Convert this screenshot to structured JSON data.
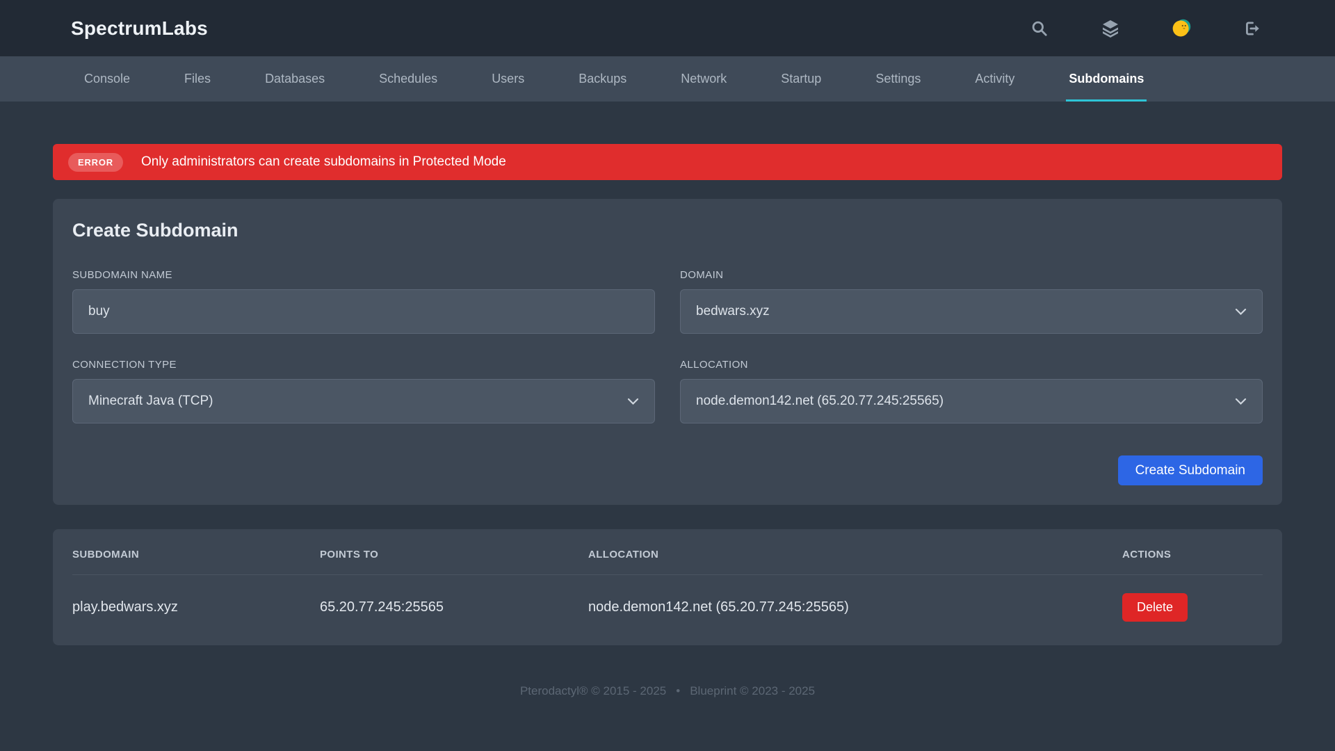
{
  "header": {
    "brand": "SpectrumLabs",
    "icons": [
      "search-icon",
      "layers-icon",
      "user-avatar",
      "logout-icon"
    ]
  },
  "nav": {
    "tabs": [
      {
        "label": "Console",
        "active": false
      },
      {
        "label": "Files",
        "active": false
      },
      {
        "label": "Databases",
        "active": false
      },
      {
        "label": "Schedules",
        "active": false
      },
      {
        "label": "Users",
        "active": false
      },
      {
        "label": "Backups",
        "active": false
      },
      {
        "label": "Network",
        "active": false
      },
      {
        "label": "Startup",
        "active": false
      },
      {
        "label": "Settings",
        "active": false
      },
      {
        "label": "Activity",
        "active": false
      },
      {
        "label": "Subdomains",
        "active": true
      }
    ],
    "active_underline_color": "#2ec4d6"
  },
  "alert": {
    "badge": "ERROR",
    "message": "Only administrators can create subdomains in Protected Mode",
    "background_color": "#e02d2d"
  },
  "form": {
    "title": "Create Subdomain",
    "fields": {
      "subdomain_name": {
        "label": "SUBDOMAIN NAME",
        "value": "buy"
      },
      "domain": {
        "label": "DOMAIN",
        "value": "bedwars.xyz"
      },
      "connection_type": {
        "label": "CONNECTION TYPE",
        "value": "Minecraft Java (TCP)"
      },
      "allocation": {
        "label": "ALLOCATION",
        "value": "node.demon142.net (65.20.77.245:25565)"
      }
    },
    "submit_label": "Create Subdomain",
    "submit_color": "#2d66e5"
  },
  "table": {
    "headers": [
      "SUBDOMAIN",
      "POINTS TO",
      "ALLOCATION",
      "ACTIONS"
    ],
    "rows": [
      {
        "subdomain": "play.bedwars.xyz",
        "points_to": "65.20.77.245:25565",
        "allocation": "node.demon142.net (65.20.77.245:25565)",
        "action_label": "Delete"
      }
    ],
    "delete_color": "#df2626"
  },
  "footer": {
    "left": "Pterodactyl® © 2015 - 2025",
    "separator": "•",
    "right": "Blueprint © 2023 - 2025"
  }
}
